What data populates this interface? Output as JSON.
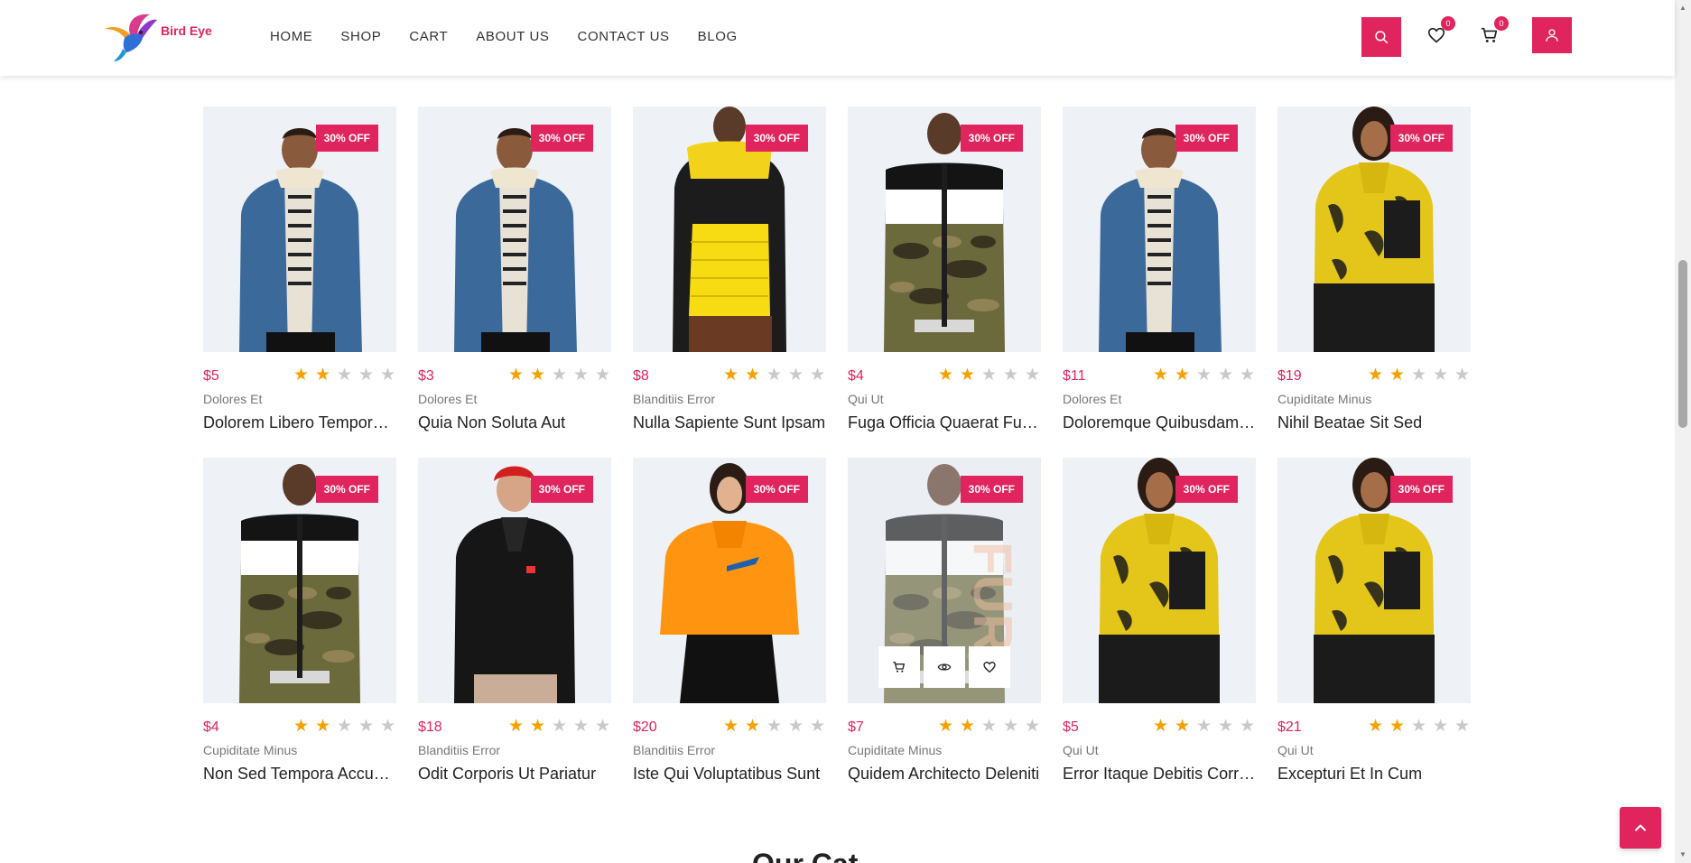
{
  "brand": {
    "name": "Bird Eye",
    "accent": "#e0245e"
  },
  "nav": [
    {
      "label": "HOME"
    },
    {
      "label": "SHOP"
    },
    {
      "label": "CART"
    },
    {
      "label": "ABOUT US"
    },
    {
      "label": "CONTACT US"
    },
    {
      "label": "BLOG"
    }
  ],
  "header": {
    "wishlist_count": "0",
    "cart_count": "0"
  },
  "discount_label": "30% OFF",
  "rating_max": 5,
  "products": [
    {
      "price": "$5",
      "rating": 2,
      "category": "Dolores Et",
      "title": "Dolorem Libero Tempore Elit",
      "style": "denim"
    },
    {
      "price": "$3",
      "rating": 2,
      "category": "Dolores Et",
      "title": "Quia Non Soluta Aut",
      "style": "denim"
    },
    {
      "price": "$8",
      "rating": 2,
      "category": "Blanditiis Error",
      "title": "Nulla Sapiente Sunt Ipsam",
      "style": "yellowpuffer"
    },
    {
      "price": "$4",
      "rating": 2,
      "category": "Qui Ut",
      "title": "Fuga Officia Quaerat Fugiat",
      "style": "camo"
    },
    {
      "price": "$11",
      "rating": 2,
      "category": "Dolores Et",
      "title": "Doloremque Quibusdam Esse",
      "style": "denim"
    },
    {
      "price": "$19",
      "rating": 2,
      "category": "Cupiditate Minus",
      "title": "Nihil Beatae Sit Sed",
      "style": "yellowfleece"
    },
    {
      "price": "$4",
      "rating": 2,
      "category": "Cupiditate Minus",
      "title": "Non Sed Tempora Accusamus",
      "style": "camo"
    },
    {
      "price": "$18",
      "rating": 2,
      "category": "Blanditiis Error",
      "title": "Odit Corporis Ut Pariatur",
      "style": "blackfleece"
    },
    {
      "price": "$20",
      "rating": 2,
      "category": "Blanditiis Error",
      "title": "Iste Qui Voluptatibus Sunt",
      "style": "orange"
    },
    {
      "price": "$7",
      "rating": 2,
      "category": "Cupiditate Minus",
      "title": "Quidem Architecto Deleniti",
      "style": "camo",
      "hover": true
    },
    {
      "price": "$5",
      "rating": 2,
      "category": "Qui Ut",
      "title": "Error Itaque Debitis Corrupti",
      "style": "yellowfleece"
    },
    {
      "price": "$21",
      "rating": 2,
      "category": "Qui Ut",
      "title": "Excepturi Et In Cum",
      "style": "yellowfleece"
    }
  ],
  "section_peek": "Our Cat"
}
